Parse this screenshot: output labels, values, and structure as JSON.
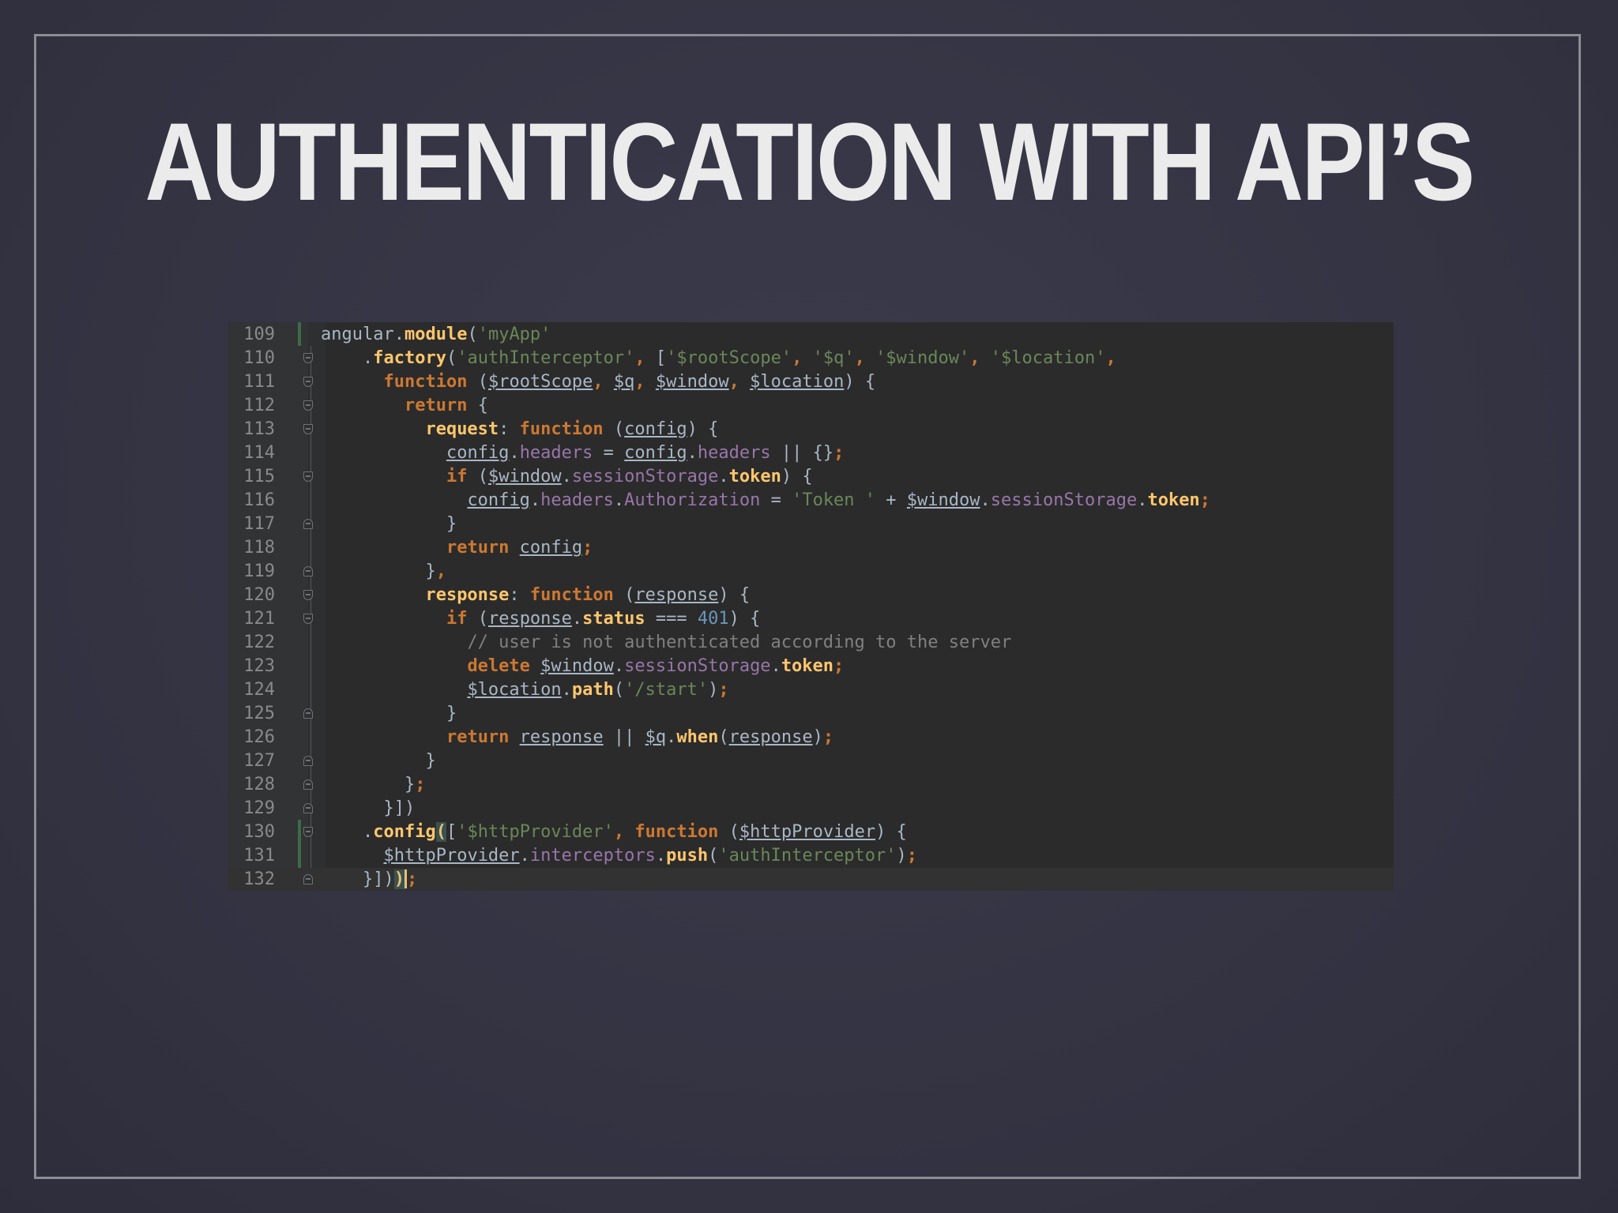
{
  "slide": {
    "title": "AUTHENTICATION WITH API’S"
  },
  "colors": {
    "keyword": "#cc7832",
    "string": "#6a8759",
    "number": "#6897bb",
    "comment": "#808080",
    "identifier": "#a9b7c6",
    "property": "#9876aa",
    "method": "#ffc66d",
    "bracket_match": "#e6c07b"
  },
  "editor": {
    "current_line": 132,
    "lines": [
      {
        "n": "109",
        "fold": "",
        "tokens": [
          [
            "",
            "angular"
          ],
          [
            "",
            "."
          ],
          [
            "m",
            "module"
          ],
          [
            "",
            "("
          ],
          [
            "s",
            "'myApp'"
          ]
        ]
      },
      {
        "n": "110",
        "fold": "open",
        "tokens": [
          [
            "",
            "    ."
          ],
          [
            "m",
            "factory"
          ],
          [
            "",
            "("
          ],
          [
            "s",
            "'authInterceptor'"
          ],
          [
            "k",
            ", "
          ],
          [
            "",
            "["
          ],
          [
            "s",
            "'$rootScope'"
          ],
          [
            "k",
            ", "
          ],
          [
            "s",
            "'$q'"
          ],
          [
            "k",
            ", "
          ],
          [
            "s",
            "'$window'"
          ],
          [
            "k",
            ", "
          ],
          [
            "s",
            "'$location'"
          ],
          [
            "k",
            ","
          ]
        ]
      },
      {
        "n": "111",
        "fold": "open",
        "tokens": [
          [
            "",
            "      "
          ],
          [
            "k",
            "function "
          ],
          [
            "",
            "("
          ],
          [
            "u",
            "$rootScope"
          ],
          [
            "k",
            ", "
          ],
          [
            "u",
            "$q"
          ],
          [
            "k",
            ", "
          ],
          [
            "u",
            "$window"
          ],
          [
            "k",
            ", "
          ],
          [
            "u",
            "$location"
          ],
          [
            "",
            ") {"
          ]
        ]
      },
      {
        "n": "112",
        "fold": "open",
        "tokens": [
          [
            "",
            "        "
          ],
          [
            "k",
            "return "
          ],
          [
            "",
            "{"
          ]
        ]
      },
      {
        "n": "113",
        "fold": "open",
        "tokens": [
          [
            "",
            "          "
          ],
          [
            "m",
            "request"
          ],
          [
            "",
            ": "
          ],
          [
            "k",
            "function "
          ],
          [
            "",
            "("
          ],
          [
            "u",
            "config"
          ],
          [
            "",
            ") {"
          ]
        ]
      },
      {
        "n": "114",
        "fold": "",
        "tokens": [
          [
            "",
            "            "
          ],
          [
            "u",
            "config"
          ],
          [
            "",
            "."
          ],
          [
            "p",
            "headers"
          ],
          [
            "",
            " = "
          ],
          [
            "u",
            "config"
          ],
          [
            "",
            "."
          ],
          [
            "p",
            "headers"
          ],
          [
            "",
            " || {}"
          ],
          [
            "k",
            ";"
          ]
        ]
      },
      {
        "n": "115",
        "fold": "open",
        "tokens": [
          [
            "",
            "            "
          ],
          [
            "k",
            "if "
          ],
          [
            "",
            "("
          ],
          [
            "u",
            "$window"
          ],
          [
            "",
            "."
          ],
          [
            "p",
            "sessionStorage"
          ],
          [
            "",
            "."
          ],
          [
            "m",
            "token"
          ],
          [
            "",
            ") {"
          ]
        ]
      },
      {
        "n": "116",
        "fold": "",
        "tokens": [
          [
            "",
            "              "
          ],
          [
            "u",
            "config"
          ],
          [
            "",
            "."
          ],
          [
            "p",
            "headers"
          ],
          [
            "",
            "."
          ],
          [
            "p",
            "Authorization"
          ],
          [
            "",
            " = "
          ],
          [
            "s",
            "'Token '"
          ],
          [
            "",
            " + "
          ],
          [
            "u",
            "$window"
          ],
          [
            "",
            "."
          ],
          [
            "p",
            "sessionStorage"
          ],
          [
            "",
            "."
          ],
          [
            "m",
            "token"
          ],
          [
            "k",
            ";"
          ]
        ]
      },
      {
        "n": "117",
        "fold": "close",
        "tokens": [
          [
            "",
            "            }"
          ]
        ]
      },
      {
        "n": "118",
        "fold": "",
        "tokens": [
          [
            "",
            "            "
          ],
          [
            "k",
            "return "
          ],
          [
            "u",
            "config"
          ],
          [
            "k",
            ";"
          ]
        ]
      },
      {
        "n": "119",
        "fold": "close",
        "tokens": [
          [
            "",
            "          }"
          ],
          [
            "k",
            ","
          ]
        ]
      },
      {
        "n": "120",
        "fold": "open",
        "tokens": [
          [
            "",
            "          "
          ],
          [
            "m",
            "response"
          ],
          [
            "",
            ": "
          ],
          [
            "k",
            "function "
          ],
          [
            "",
            "("
          ],
          [
            "u",
            "response"
          ],
          [
            "",
            ") {"
          ]
        ]
      },
      {
        "n": "121",
        "fold": "open",
        "tokens": [
          [
            "",
            "            "
          ],
          [
            "k",
            "if "
          ],
          [
            "",
            "("
          ],
          [
            "u",
            "response"
          ],
          [
            "",
            "."
          ],
          [
            "m",
            "status"
          ],
          [
            "",
            " === "
          ],
          [
            "n",
            "401"
          ],
          [
            "",
            ") {"
          ]
        ]
      },
      {
        "n": "122",
        "fold": "",
        "tokens": [
          [
            "",
            "              "
          ],
          [
            "c",
            "// user is not authenticated according to the server"
          ]
        ]
      },
      {
        "n": "123",
        "fold": "",
        "tokens": [
          [
            "",
            "              "
          ],
          [
            "k",
            "delete "
          ],
          [
            "u",
            "$window"
          ],
          [
            "",
            "."
          ],
          [
            "p",
            "sessionStorage"
          ],
          [
            "",
            "."
          ],
          [
            "m",
            "token"
          ],
          [
            "k",
            ";"
          ]
        ]
      },
      {
        "n": "124",
        "fold": "",
        "tokens": [
          [
            "",
            "              "
          ],
          [
            "u",
            "$location"
          ],
          [
            "",
            "."
          ],
          [
            "m",
            "path"
          ],
          [
            "",
            "("
          ],
          [
            "s",
            "'/start'"
          ],
          [
            "",
            ")"
          ],
          [
            "k",
            ";"
          ]
        ]
      },
      {
        "n": "125",
        "fold": "close",
        "tokens": [
          [
            "",
            "            }"
          ]
        ]
      },
      {
        "n": "126",
        "fold": "",
        "tokens": [
          [
            "",
            "            "
          ],
          [
            "k",
            "return "
          ],
          [
            "u",
            "response"
          ],
          [
            "",
            " || "
          ],
          [
            "u",
            "$q"
          ],
          [
            "",
            "."
          ],
          [
            "m",
            "when"
          ],
          [
            "",
            "("
          ],
          [
            "u",
            "response"
          ],
          [
            "",
            ")"
          ],
          [
            "k",
            ";"
          ]
        ]
      },
      {
        "n": "127",
        "fold": "close",
        "tokens": [
          [
            "",
            "          }"
          ]
        ]
      },
      {
        "n": "128",
        "fold": "close",
        "tokens": [
          [
            "",
            "        }"
          ],
          [
            "k",
            ";"
          ]
        ]
      },
      {
        "n": "129",
        "fold": "close",
        "tokens": [
          [
            "",
            "      }])"
          ]
        ]
      },
      {
        "n": "130",
        "fold": "open",
        "tokens": [
          [
            "",
            "    ."
          ],
          [
            "m",
            "config"
          ],
          [
            "b",
            "("
          ],
          [
            "",
            "["
          ],
          [
            "s",
            "'$httpProvider'"
          ],
          [
            "k",
            ", "
          ],
          [
            "k",
            "function "
          ],
          [
            "",
            "("
          ],
          [
            "u",
            "$httpProvider"
          ],
          [
            "",
            ") {"
          ]
        ]
      },
      {
        "n": "131",
        "fold": "",
        "tokens": [
          [
            "",
            "      "
          ],
          [
            "u",
            "$httpProvider"
          ],
          [
            "",
            "."
          ],
          [
            "p",
            "interceptors"
          ],
          [
            "",
            "."
          ],
          [
            "m",
            "push"
          ],
          [
            "",
            "("
          ],
          [
            "s",
            "'authInterceptor'"
          ],
          [
            "",
            ")"
          ],
          [
            "k",
            ";"
          ]
        ]
      },
      {
        "n": "132",
        "fold": "close",
        "tokens": [
          [
            "",
            "    }])"
          ],
          [
            "b",
            ")"
          ],
          [
            "k",
            ";"
          ]
        ]
      }
    ]
  }
}
